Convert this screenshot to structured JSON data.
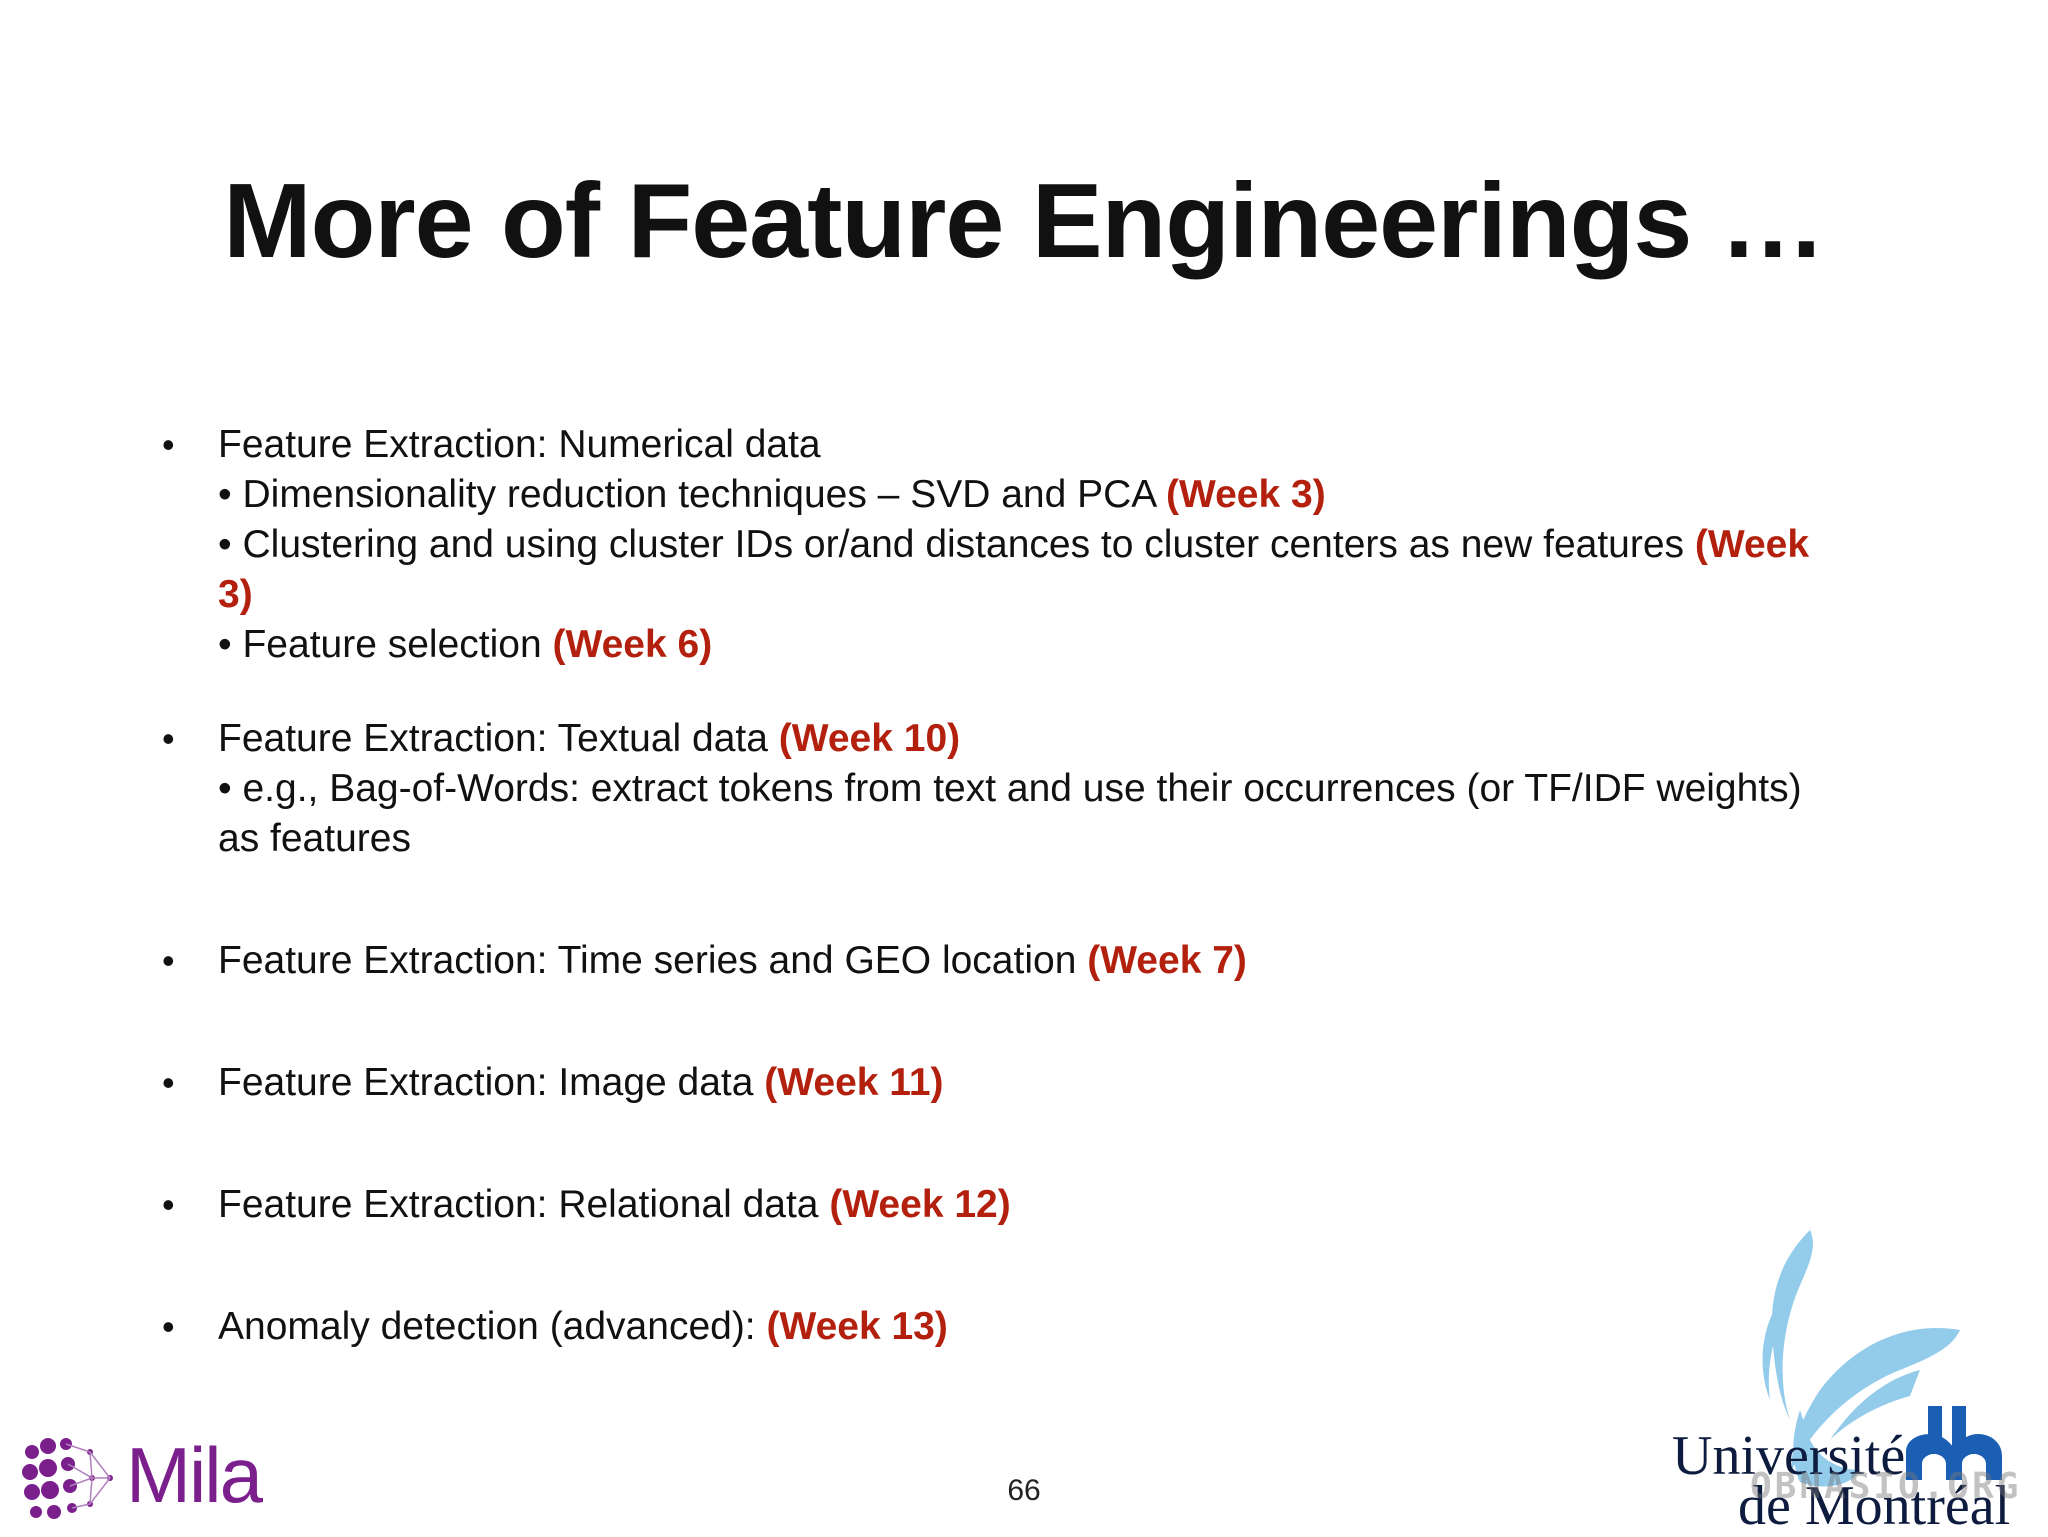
{
  "slide": {
    "title": "More of Feature Engineerings …",
    "page_number": "66"
  },
  "bullets": [
    {
      "main": "Feature Extraction: Numerical data",
      "subs": [
        {
          "text": "• Dimensionality reduction techniques – SVD and PCA ",
          "week": "(Week 3)"
        },
        {
          "text": "• Clustering and using cluster IDs or/and distances to cluster centers as new features ",
          "week": "(Week 3)"
        },
        {
          "text": "• Feature selection ",
          "week": "(Week 6)"
        }
      ]
    },
    {
      "main": "Feature Extraction: Textual data ",
      "week": "(Week 10)",
      "subs": [
        {
          "text": "• e.g., Bag-of-Words: extract tokens from text and use their occurrences (or TF/IDF weights) as features"
        }
      ]
    },
    {
      "main": "Feature Extraction: Time series and GEO location ",
      "week": "(Week 7)"
    },
    {
      "main": "Feature Extraction: Image data ",
      "week": "(Week 11)"
    },
    {
      "main": "Feature Extraction: Relational data ",
      "week": "(Week 12)"
    },
    {
      "main": "Anomaly detection (advanced): ",
      "week": "(Week 13)"
    }
  ],
  "logos": {
    "mila": "Mila",
    "udem_line1": "Université",
    "udem_line2": "de Montréal",
    "watermark": "OBNASIO.ORG"
  },
  "colors": {
    "week_highlight": "#b3200e",
    "mila_purple": "#7b1f8c",
    "udem_blue": "#1a5fb4",
    "udem_bird": "#8ec9ea"
  }
}
